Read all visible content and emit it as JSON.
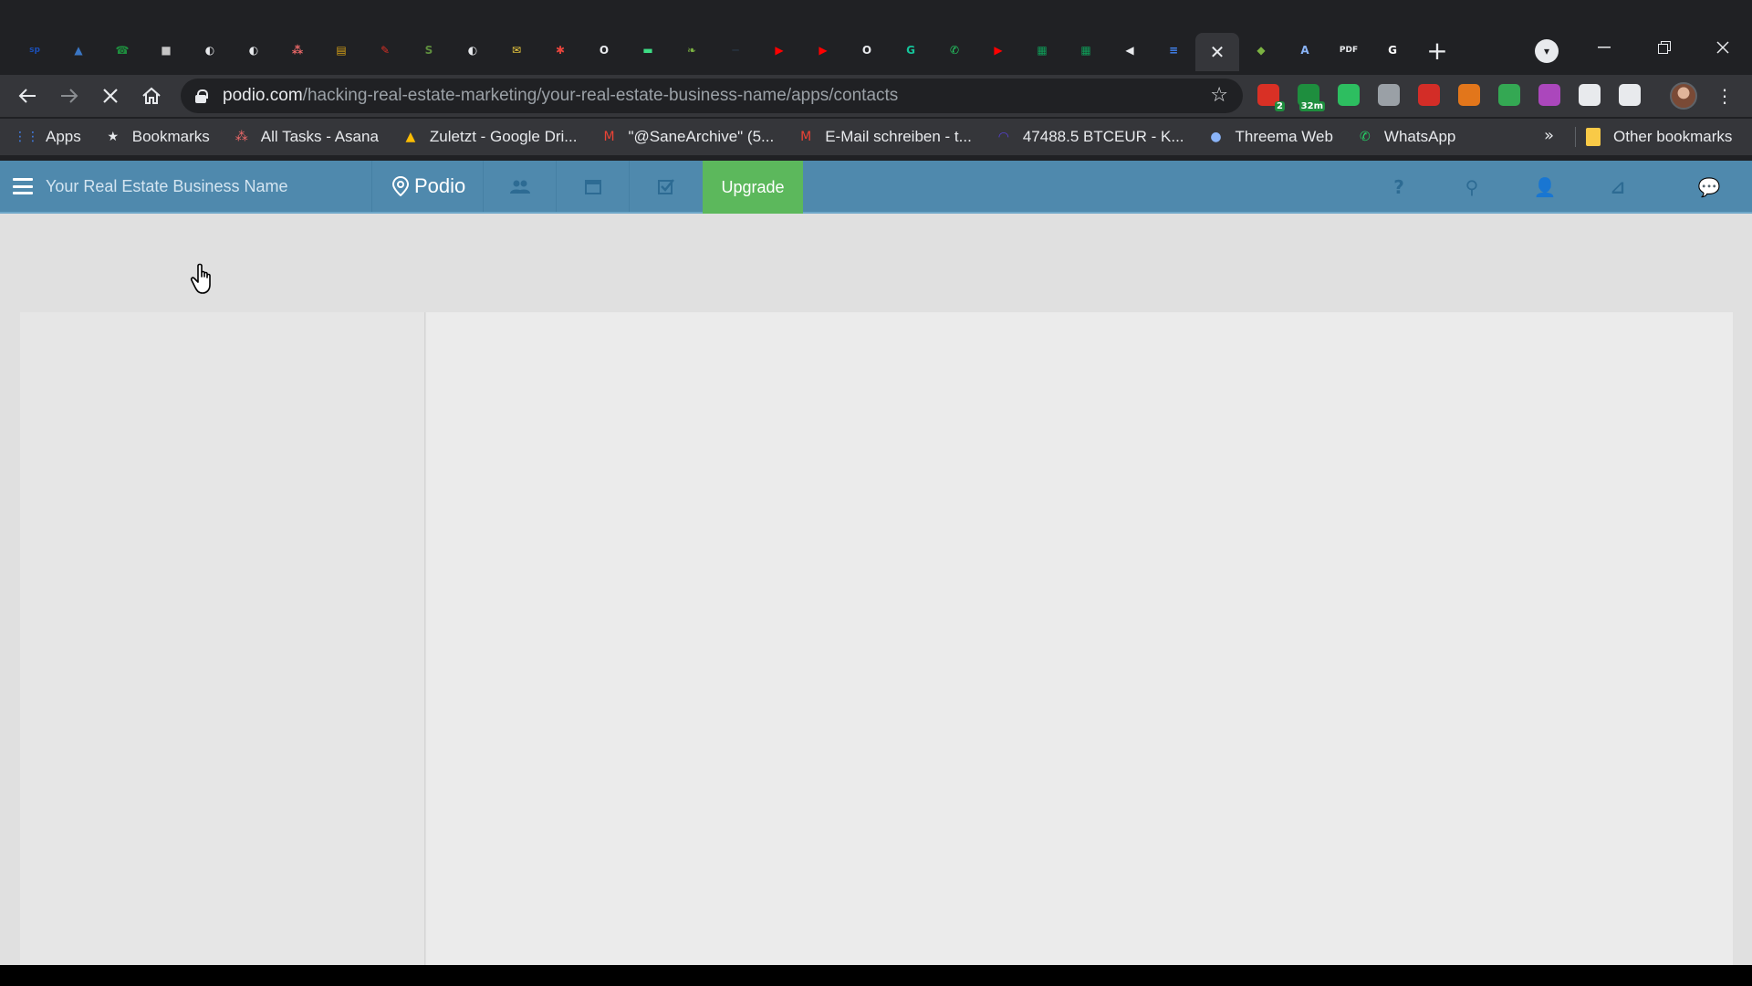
{
  "browser": {
    "tabs": [
      {
        "icon": "sp-icon",
        "glyph": "sp",
        "color": "#1a4fb8"
      },
      {
        "icon": "photo-icon",
        "glyph": "▲",
        "color": "#3a76c4"
      },
      {
        "icon": "phone-icon",
        "glyph": "☎",
        "color": "#1e8e3e"
      },
      {
        "icon": "document-icon",
        "glyph": "■",
        "color": "#c5c5c5"
      },
      {
        "icon": "globe-icon",
        "glyph": "◐",
        "color": "#e8eaed"
      },
      {
        "icon": "globe-icon",
        "glyph": "◐",
        "color": "#e8eaed"
      },
      {
        "icon": "asana-icon",
        "glyph": "⁂",
        "color": "#f06a6a"
      },
      {
        "icon": "book-icon",
        "glyph": "▤",
        "color": "#d4a017"
      },
      {
        "icon": "pen-icon",
        "glyph": "✎",
        "color": "#d93025"
      },
      {
        "icon": "shopify-icon",
        "glyph": "S",
        "color": "#5e8e3e"
      },
      {
        "icon": "globe-icon",
        "glyph": "◐",
        "color": "#e8eaed"
      },
      {
        "icon": "mail-icon",
        "glyph": "✉",
        "color": "#f4d03f"
      },
      {
        "icon": "asterisk-icon",
        "glyph": "✱",
        "color": "#e8453c"
      },
      {
        "icon": "o-icon",
        "glyph": "O",
        "color": "#e8eaed"
      },
      {
        "icon": "android-icon",
        "glyph": "▬",
        "color": "#3ddc84"
      },
      {
        "icon": "leaf-icon",
        "glyph": "❧",
        "color": "#7cb342"
      },
      {
        "icon": "dash-icon",
        "glyph": "─",
        "color": "#2c3e50"
      },
      {
        "icon": "youtube-icon",
        "glyph": "▶",
        "color": "#ff0000"
      },
      {
        "icon": "youtube-icon",
        "glyph": "▶",
        "color": "#ff0000"
      },
      {
        "icon": "o-icon",
        "glyph": "O",
        "color": "#e8eaed"
      },
      {
        "icon": "grammarly-icon",
        "glyph": "G",
        "color": "#15c39a"
      },
      {
        "icon": "whatsapp-icon",
        "glyph": "✆",
        "color": "#25d366"
      },
      {
        "icon": "youtube-icon",
        "glyph": "▶",
        "color": "#ff0000"
      },
      {
        "icon": "sheets-icon",
        "glyph": "▦",
        "color": "#0f9d58"
      },
      {
        "icon": "sheets-icon",
        "glyph": "▦",
        "color": "#0f9d58"
      },
      {
        "icon": "speaker-icon",
        "glyph": "◀",
        "color": "#e8eaed"
      },
      {
        "icon": "docs-icon",
        "glyph": "≡",
        "color": "#4285f4"
      }
    ],
    "active_tab": {
      "close_glyph": "✕"
    },
    "tabs_after": [
      {
        "icon": "map-icon",
        "glyph": "◆",
        "color": "#7cb342"
      },
      {
        "icon": "translate-icon",
        "glyph": "A",
        "color": "#8ab4f8"
      },
      {
        "icon": "pdf-icon",
        "glyph": "PDF",
        "color": "#e8eaed"
      },
      {
        "icon": "google-icon",
        "glyph": "G",
        "color": "#ffffff"
      }
    ],
    "new_tab_glyph": "+",
    "url_host": "podio.com",
    "url_path": "/hacking-real-estate-marketing/your-real-estate-business-name/apps/contacts",
    "extensions": [
      {
        "icon": "calendar-ext-icon",
        "badge": "2",
        "color": "#d93025"
      },
      {
        "icon": "timer-ext-icon",
        "badge": "32m",
        "color": "#1e8e3e"
      },
      {
        "icon": "evernote-ext-icon",
        "badge": "",
        "color": "#2dbe60"
      },
      {
        "icon": "pocket-ext-icon",
        "badge": "",
        "color": "#9aa0a6"
      },
      {
        "icon": "lastpass-ext-icon",
        "badge": "",
        "color": "#d32d27"
      },
      {
        "icon": "metamask-ext-icon",
        "badge": "",
        "color": "#e2761b"
      },
      {
        "icon": "grid-ext-icon",
        "badge": "",
        "color": "#34a853"
      },
      {
        "icon": "color-ext-icon",
        "badge": "",
        "color": "#ab47bc"
      },
      {
        "icon": "puzzle-icon",
        "badge": "",
        "color": "#e8eaed"
      },
      {
        "icon": "playlist-icon",
        "badge": "",
        "color": "#e8eaed"
      }
    ],
    "bookmarks": [
      {
        "label": "Apps",
        "icon": "apps-grid-icon",
        "color": "#4285f4"
      },
      {
        "label": "Bookmarks",
        "icon": "star-icon",
        "color": "#e8eaed"
      },
      {
        "label": "All Tasks - Asana",
        "icon": "asana-icon",
        "color": "#f06a6a"
      },
      {
        "label": "Zuletzt - Google Dri...",
        "icon": "drive-icon",
        "color": "#fbbc04"
      },
      {
        "label": "\"@SaneArchive\" (5...",
        "icon": "gmail-icon",
        "color": "#ea4335"
      },
      {
        "label": "E-Mail schreiben - t...",
        "icon": "gmail-icon",
        "color": "#ea4335"
      },
      {
        "label": "47488.5 BTCEUR - K...",
        "icon": "kraken-icon",
        "color": "#5741d9"
      },
      {
        "label": "Threema Web",
        "icon": "threema-icon",
        "color": "#8ab4f8"
      },
      {
        "label": "WhatsApp",
        "icon": "whatsapp-icon",
        "color": "#25d366"
      }
    ],
    "bookmarks_more": "»",
    "other_bookmarks": "Other bookmarks"
  },
  "podio": {
    "workspace_name": "Your Real Estate Business Name",
    "brand": "Podio",
    "upgrade_label": "Upgrade",
    "nav_icons": [
      "contacts-icon",
      "calendar-icon",
      "tasks-icon"
    ],
    "right_icons": [
      {
        "icon": "help-icon",
        "glyph": "?"
      },
      {
        "icon": "search-icon",
        "glyph": "⚲"
      },
      {
        "icon": "user-menu-icon",
        "glyph": "👤"
      },
      {
        "icon": "activity-icon",
        "glyph": "⊿"
      },
      {
        "icon": "chat-icon",
        "glyph": "💬"
      }
    ],
    "accent": "#4f89ad",
    "upgrade_color": "#5cb85c"
  }
}
